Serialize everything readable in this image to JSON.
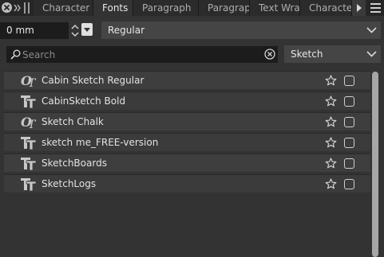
{
  "tabs": [
    {
      "label": "Character",
      "active": false
    },
    {
      "label": "Fonts",
      "active": true
    },
    {
      "label": "Paragraph",
      "active": false
    },
    {
      "label": "Paragrap",
      "active": false
    },
    {
      "label": "Text Wra",
      "active": false
    },
    {
      "label": "Characte",
      "active": false
    }
  ],
  "tabbar_icons": {
    "close": "close-circle-icon",
    "expand": "double-chevron-right-icon",
    "grip": "grip-icon",
    "more": "triangle-right-icon",
    "menu": "hamburger-menu-icon"
  },
  "size_field": {
    "value": "0 mm"
  },
  "style_select": {
    "value": "Regular"
  },
  "search": {
    "placeholder": "Search",
    "value": ""
  },
  "filter_select": {
    "value": "Sketch"
  },
  "fonts": [
    {
      "name": "Cabin Sketch Regular",
      "type": "opentype",
      "icon": "opentype-font-icon"
    },
    {
      "name": "CabinSketch Bold",
      "type": "truetype",
      "icon": "truetype-font-icon"
    },
    {
      "name": "Sketch Chalk",
      "type": "opentype",
      "icon": "opentype-font-icon"
    },
    {
      "name": "sketch me_FREE-version",
      "type": "truetype",
      "icon": "truetype-font-icon"
    },
    {
      "name": "SketchBoards",
      "type": "truetype",
      "icon": "truetype-font-icon"
    },
    {
      "name": "SketchLogs",
      "type": "truetype",
      "icon": "truetype-font-icon"
    }
  ],
  "colors": {
    "background": "#333333",
    "tabbar": "#262626",
    "field": "#1c1c1c",
    "row": "#3b3b3b",
    "text": "#e2e2e2"
  }
}
